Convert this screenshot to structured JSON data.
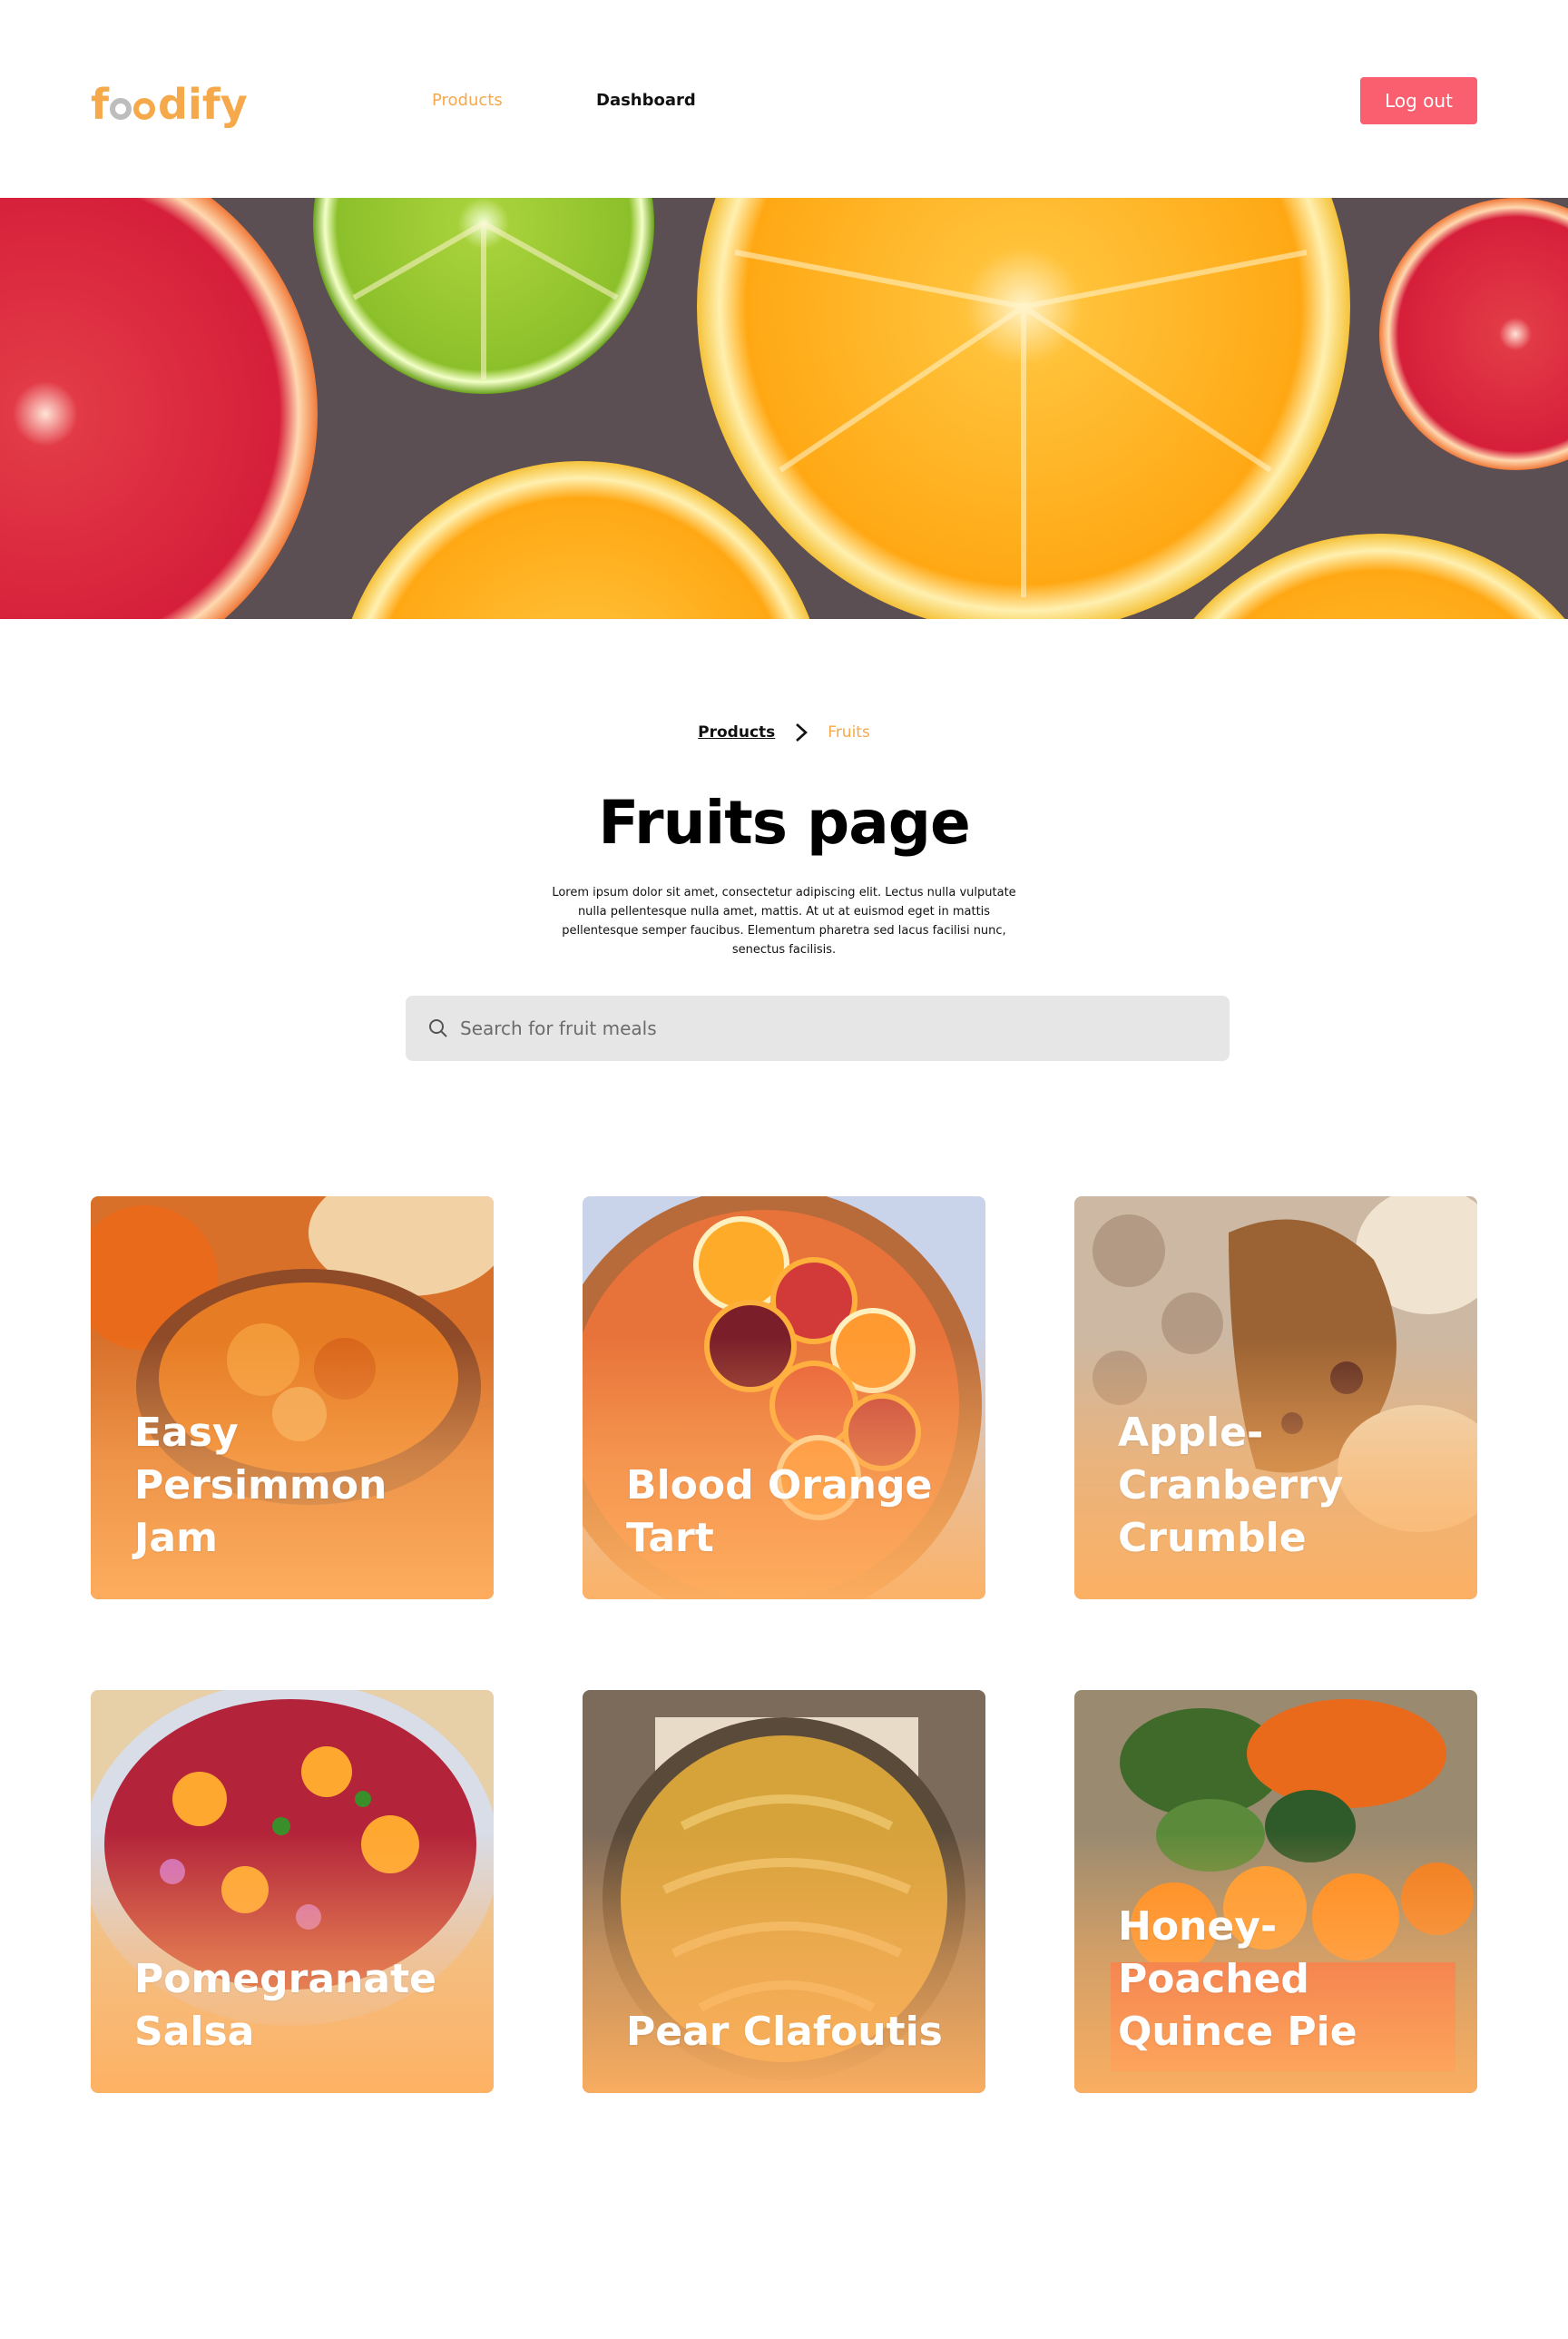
{
  "header": {
    "logo_text": "foodify",
    "logo_parts": {
      "before": "f",
      "after": "dify"
    },
    "nav": {
      "products": "Products",
      "dashboard": "Dashboard"
    },
    "logout_label": "Log out"
  },
  "breadcrumb": {
    "parent": "Products",
    "current": "Fruits"
  },
  "page": {
    "title": "Fruits page",
    "description": "Lorem ipsum dolor sit amet, consectetur adipiscing elit. Lectus nulla vulputate nulla pellentesque nulla amet, mattis. At ut at euismod eget in mattis pellentesque semper faucibus. Elementum pharetra sed lacus facilisi nunc, senectus facilisis."
  },
  "search": {
    "placeholder": "Search for fruit meals",
    "value": ""
  },
  "cards": [
    {
      "title": "Easy Persimmon Jam"
    },
    {
      "title": "Blood Orange Tart"
    },
    {
      "title": "Apple-Cranberry Crumble"
    },
    {
      "title": "Pomegranate Salsa"
    },
    {
      "title": "Pear Clafoutis"
    },
    {
      "title": "Honey-Poached Quince Pie"
    }
  ],
  "colors": {
    "accent": "#f6a94b",
    "logout": "#fa5f6f",
    "search_bg": "#e6e6e6",
    "card_overlay": "#ffb060"
  },
  "icons": {
    "search": "search-icon",
    "breadcrumb_separator": "chevron-right-icon"
  }
}
